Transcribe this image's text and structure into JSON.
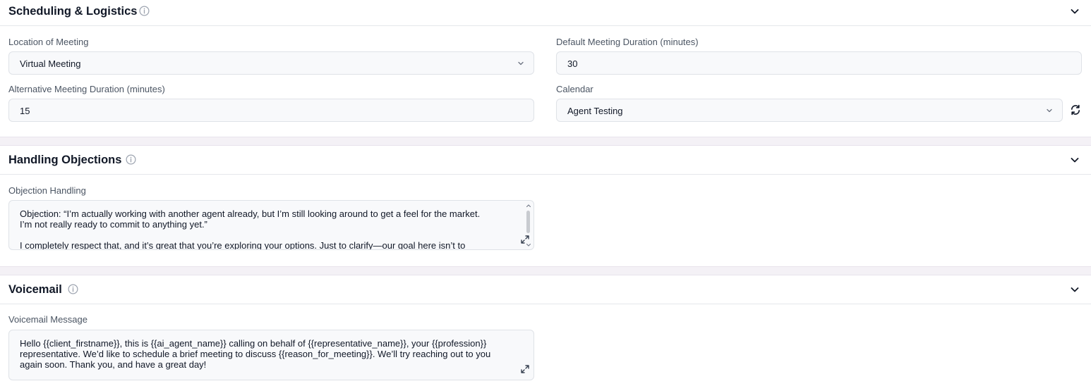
{
  "sections": {
    "scheduling": {
      "title": "Scheduling & Logistics",
      "location_label": "Location of Meeting",
      "location_value": "Virtual Meeting",
      "default_duration_label": "Default Meeting Duration (minutes)",
      "default_duration_value": "30",
      "alt_duration_label": "Alternative Meeting Duration (minutes)",
      "alt_duration_value": "15",
      "calendar_label": "Calendar",
      "calendar_value": "Agent Testing"
    },
    "objections": {
      "title": "Handling Objections",
      "objection_label": "Objection Handling",
      "objection_text": "Objection: “I’m actually working with another agent already, but I’m still looking around to get a feel for the market.\nI’m not really ready to commit to anything yet.”\n\nI completely respect that, and it’s great that you’re exploring your options. Just to clarify—our goal here isn’t to"
    },
    "voicemail": {
      "title": "Voicemail",
      "message_label": "Voicemail Message",
      "message_text": "Hello {{client_firstname}}, this is {{ai_agent_name}} calling on behalf of {{representative_name}}, your {{profession}}\nrepresentative. We’d like to schedule a brief meeting to discuss {{reason_for_meeting}}. We’ll try reaching out to you\nagain soon. Thank you, and have a great day!"
    }
  },
  "icons": {
    "info": "info-icon",
    "chevron": "chevron-down-icon",
    "refresh": "refresh-icon",
    "expand": "expand-icon"
  },
  "colors": {
    "divider_band": "#f4f1f6",
    "field_background": "#f8f9fb",
    "border": "#dfe2e7",
    "label": "#4b5563",
    "text": "#111827"
  }
}
